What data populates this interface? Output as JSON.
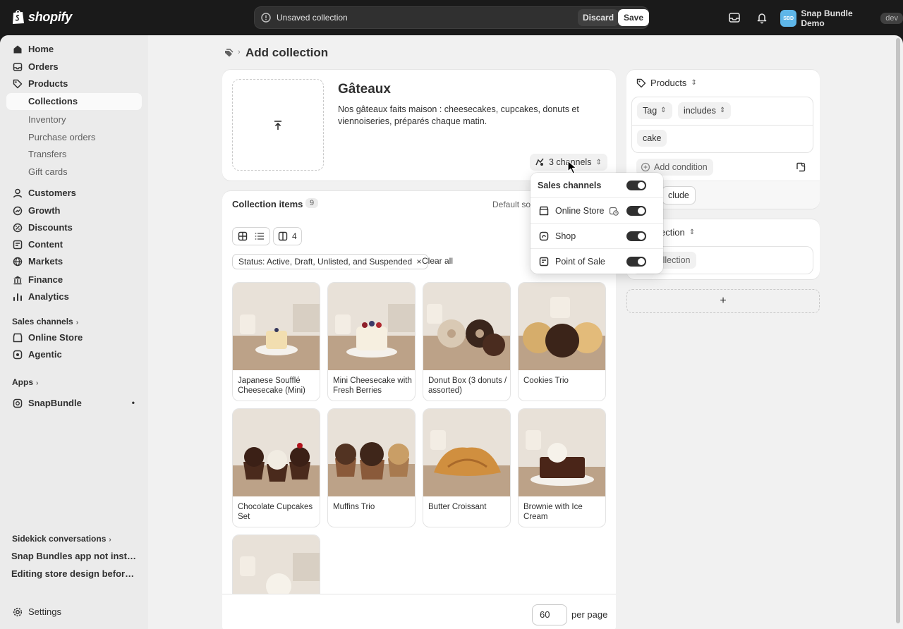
{
  "topbar": {
    "brand": "shopify",
    "unsaved_label": "Unsaved collection",
    "discard_label": "Discard",
    "save_label": "Save",
    "store_initials": "SBD",
    "store_name": "Snap Bundle Demo",
    "store_badge": "dev"
  },
  "sidebar": {
    "main_items": [
      {
        "label": "Home",
        "icon": "home-icon"
      },
      {
        "label": "Orders",
        "icon": "orders-icon"
      },
      {
        "label": "Products",
        "icon": "tag-icon"
      }
    ],
    "products_sub": [
      "Collections",
      "Inventory",
      "Purchase orders",
      "Transfers",
      "Gift cards"
    ],
    "more_items": [
      {
        "label": "Customers",
        "icon": "person-icon"
      },
      {
        "label": "Growth",
        "icon": "growth-icon"
      },
      {
        "label": "Discounts",
        "icon": "discount-icon"
      },
      {
        "label": "Content",
        "icon": "content-icon"
      },
      {
        "label": "Markets",
        "icon": "globe-icon"
      },
      {
        "label": "Finance",
        "icon": "bank-icon"
      },
      {
        "label": "Analytics",
        "icon": "chart-icon"
      }
    ],
    "sales_channels_heading": "Sales channels",
    "channel_items": [
      "Online Store",
      "Agentic"
    ],
    "apps_heading": "Apps",
    "app_items": [
      "SnapBundle"
    ],
    "sidekick_heading": "Sidekick conversations",
    "sidekick_items": [
      "Snap Bundles app not installed",
      "Editing store design before lau..."
    ],
    "settings_label": "Settings"
  },
  "page": {
    "title": "Add collection"
  },
  "collection": {
    "title": "Gâteaux",
    "description": "Nos gâteaux faits maison : cheesecakes, cupcakes, donuts et viennoiseries, préparés chaque matin.",
    "channels_button": "3 channels"
  },
  "items": {
    "title": "Collection items",
    "count": "9",
    "sort_label": "Default sor",
    "view_count": "4",
    "filter": "Status: Active, Draft, Unlisted, and Suspended",
    "filter_remove": "×",
    "clear_all": "Clear all",
    "products": [
      "Japanese Soufflé Cheesecake (Mini)",
      "Mini Cheesecake with Fresh Berries",
      "Donut Box (3 donuts / assorted)",
      "Cookies Trio",
      "Chocolate Cupcakes Set",
      "Muffins Trio",
      "Butter Croissant",
      "Brownie with Ice Cream",
      ""
    ],
    "per_page_value": "60",
    "per_page_label": "per page"
  },
  "conditions": {
    "heading": "Products",
    "field": "Tag",
    "operator": "includes",
    "value": "cake",
    "add_condition": "Add condition",
    "exclude": "clude"
  },
  "collection_card": {
    "heading": "ection",
    "add_collection": "dd collection"
  },
  "popover": {
    "heading": "Sales channels",
    "channels": [
      "Online Store",
      "Shop",
      "Point of Sale"
    ]
  },
  "colors": {
    "topbar": "#1a1a1a",
    "page_bg": "#f1f1f1",
    "sidebar_bg": "#ebebeb",
    "card_bg": "#ffffff",
    "text": "#303030",
    "toggle_on": "#303030",
    "store_avatar": "#5eb6e8"
  }
}
